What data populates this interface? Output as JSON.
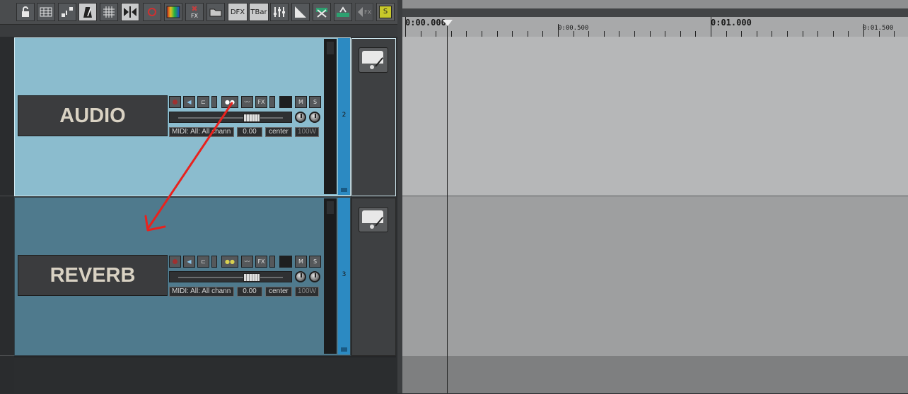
{
  "toolbar": {
    "buttons": [
      {
        "name": "lock-icon"
      },
      {
        "name": "grid-view-icon"
      },
      {
        "name": "routing-icon"
      },
      {
        "name": "metronome-icon"
      },
      {
        "name": "snap-grid-icon"
      },
      {
        "name": "ripple-edit-icon"
      },
      {
        "name": "auto-crossfade-icon"
      },
      {
        "name": "spectrum-icon"
      },
      {
        "name": "fx-bypass-icon",
        "label": "FX"
      },
      {
        "name": "folder-icon"
      },
      {
        "name": "dfx-button",
        "label": "DFX"
      },
      {
        "name": "tbar-button",
        "label": "TBar"
      },
      {
        "name": "mixer-icon"
      },
      {
        "name": "envelope-icon"
      },
      {
        "name": "tools-icon"
      },
      {
        "name": "settings-icon"
      },
      {
        "name": "fx-chain-icon"
      },
      {
        "name": "solo-icon",
        "label": "S"
      }
    ]
  },
  "timeline": {
    "labels": [
      {
        "text": "0:00.000",
        "kind": "major"
      },
      {
        "text": "0:00.500",
        "kind": "minor"
      },
      {
        "text": "0:01.000",
        "kind": "major"
      },
      {
        "text": "0:01.500",
        "kind": "minor"
      }
    ]
  },
  "tracks": [
    {
      "name": "AUDIO",
      "number": "2",
      "midi_input": "MIDI: All: All chann",
      "volume": "0.00",
      "pan": "center",
      "width": "100W",
      "selected": true,
      "color": "#8bbcce"
    },
    {
      "name": "REVERB",
      "number": "3",
      "midi_input": "MIDI: All: All chann",
      "volume": "0.00",
      "pan": "center",
      "width": "100W",
      "selected": false,
      "color": "#4f7a8d"
    }
  ],
  "track_buttons": {
    "fx": "FX",
    "mute": "M",
    "solo": "S"
  },
  "annotation": {
    "color": "#e8221e"
  }
}
